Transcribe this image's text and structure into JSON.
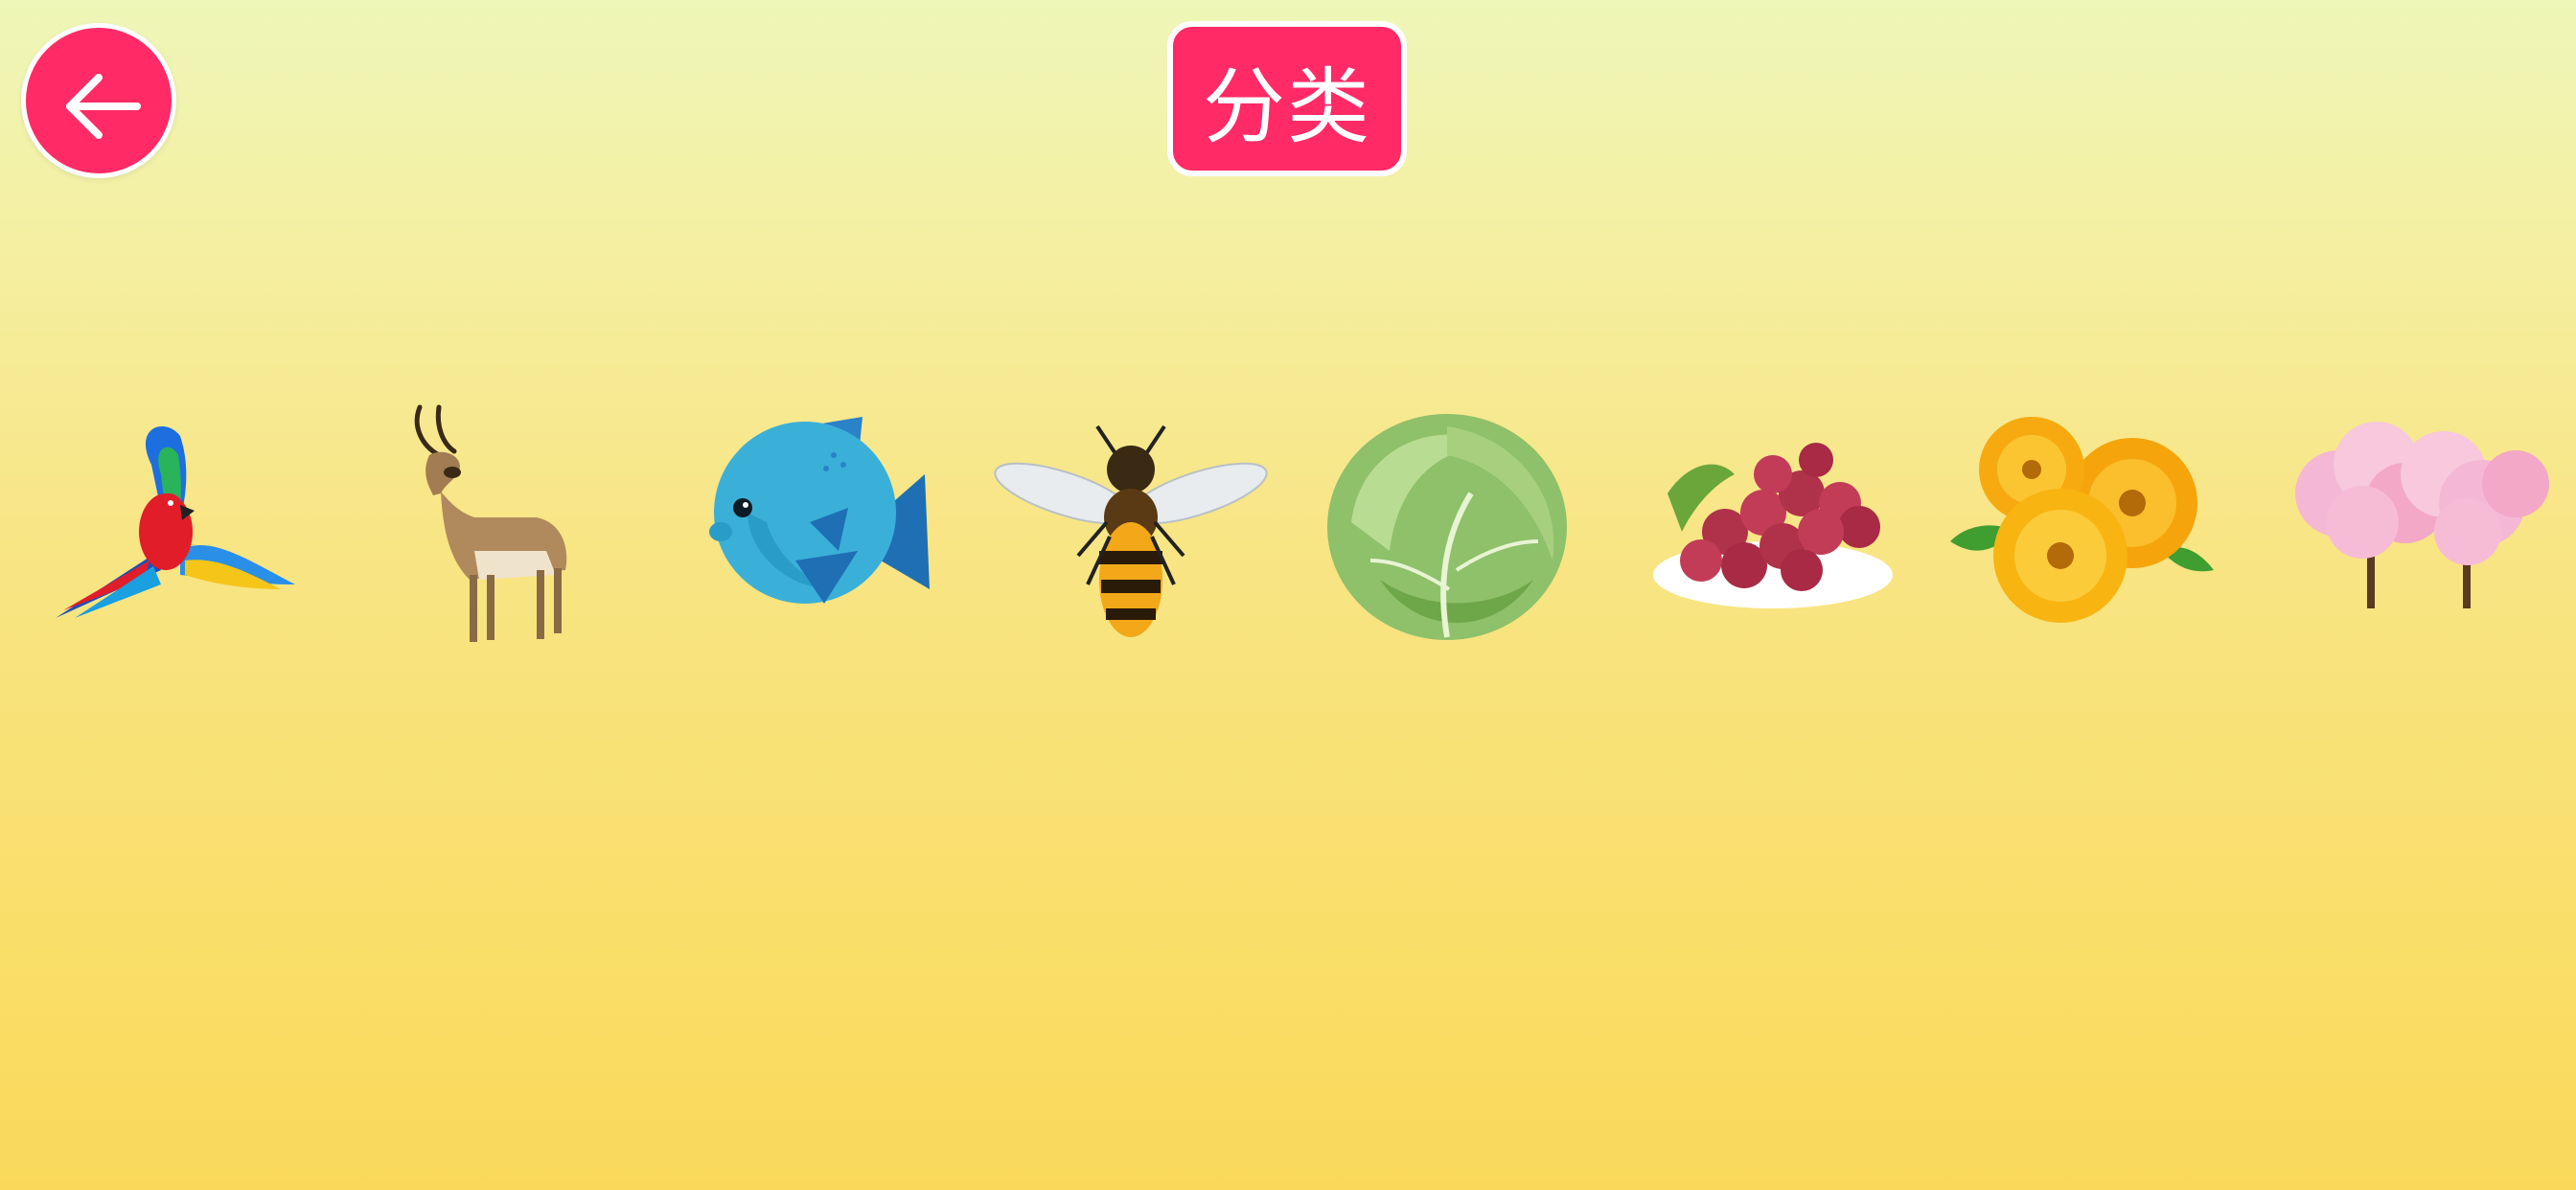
{
  "header": {
    "title": "分类",
    "back_icon": "arrow-left-icon"
  },
  "items": [
    {
      "icon": "parrot"
    },
    {
      "icon": "antelope"
    },
    {
      "icon": "fish"
    },
    {
      "icon": "bee"
    },
    {
      "icon": "cabbage"
    },
    {
      "icon": "grapes"
    },
    {
      "icon": "flower"
    },
    {
      "icon": "tree"
    }
  ],
  "colors": {
    "accent": "#ff2a66",
    "background_top": "#eef6b8",
    "background_bottom": "#fad95a"
  }
}
